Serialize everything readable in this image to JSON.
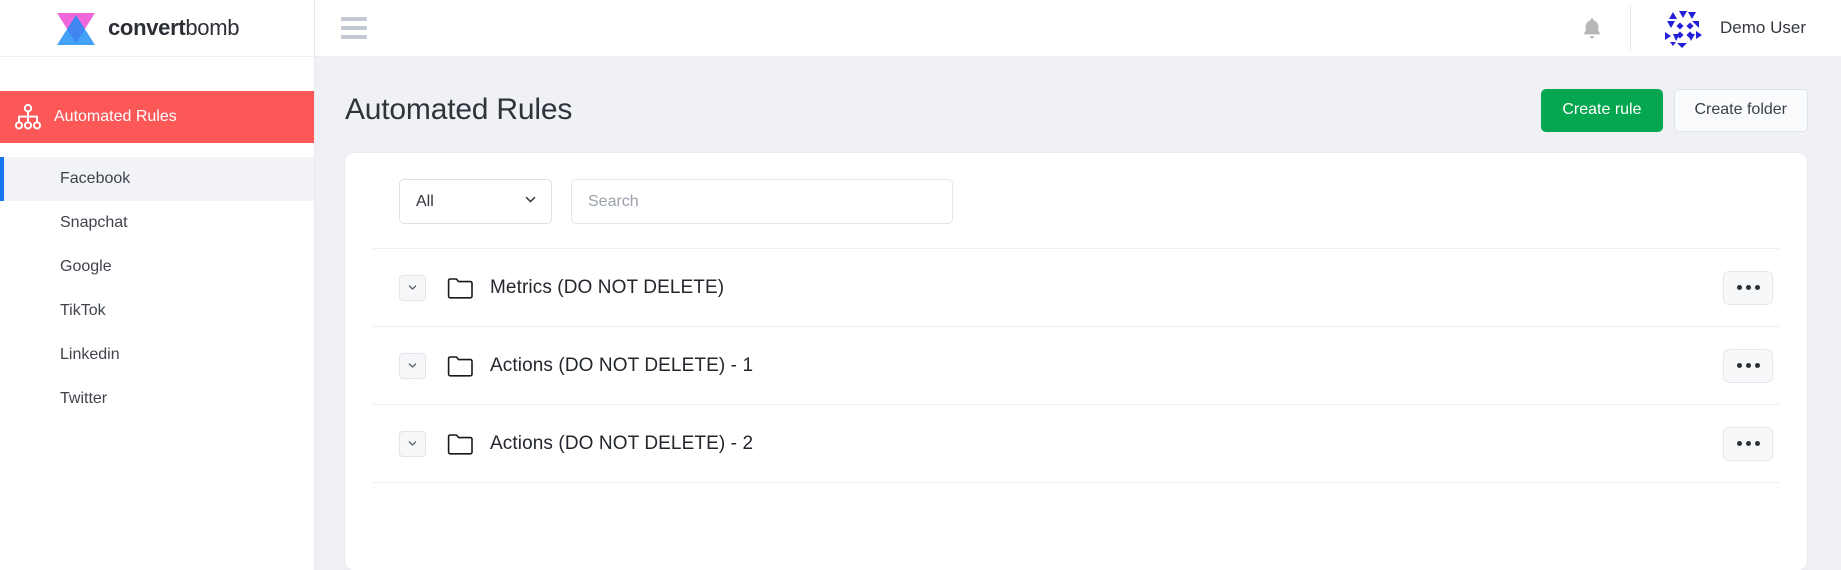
{
  "brand": {
    "logo_icon": "hourglass-logo-icon",
    "name_bold": "convert",
    "name_light": "bomb",
    "color_pink": "#ef5fd8",
    "color_blue": "#1a8cf5"
  },
  "sidebar": {
    "section": {
      "label": "Automated Rules",
      "icon": "sitemap-icon",
      "bg_color": "#fd5858"
    },
    "items": [
      {
        "label": "Facebook",
        "active": true
      },
      {
        "label": "Snapchat",
        "active": false
      },
      {
        "label": "Google",
        "active": false
      },
      {
        "label": "TikTok",
        "active": false
      },
      {
        "label": "Linkedin",
        "active": false
      },
      {
        "label": "Twitter",
        "active": false
      }
    ],
    "active_indicator_color": "#1875f0"
  },
  "topbar": {
    "menu_icon": "hamburger-menu-icon",
    "notification_icon": "bell-icon",
    "avatar_icon": "user-avatar-identicon",
    "user_name": "Demo User"
  },
  "page": {
    "title": "Automated Rules",
    "create_rule_label": "Create rule",
    "create_folder_label": "Create folder",
    "primary_color": "#05a650"
  },
  "filters": {
    "select_value": "All",
    "select_icon": "chevron-down-icon",
    "search_placeholder": "Search",
    "search_value": ""
  },
  "rows": [
    {
      "label": "Metrics (DO NOT DELETE)",
      "expand_icon": "chevron-down-icon",
      "type_icon": "folder-icon",
      "menu_icon": "ellipsis-icon"
    },
    {
      "label": "Actions (DO NOT DELETE) - 1",
      "expand_icon": "chevron-down-icon",
      "type_icon": "folder-icon",
      "menu_icon": "ellipsis-icon"
    },
    {
      "label": "Actions (DO NOT DELETE) - 2",
      "expand_icon": "chevron-down-icon",
      "type_icon": "folder-icon",
      "menu_icon": "ellipsis-icon"
    }
  ]
}
